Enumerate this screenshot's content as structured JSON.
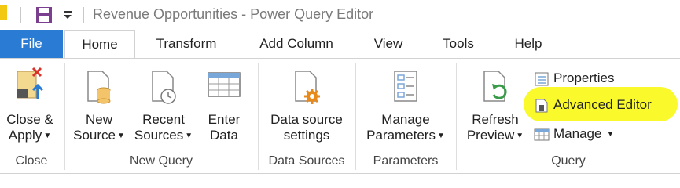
{
  "window": {
    "title": "Revenue Opportunities - Power Query Editor"
  },
  "tabs": [
    "File",
    "Home",
    "Transform",
    "Add Column",
    "View",
    "Tools",
    "Help"
  ],
  "groups": {
    "close": {
      "label": "Close",
      "close_apply": {
        "line1": "Close &",
        "line2": "Apply"
      }
    },
    "new_query": {
      "label": "New Query",
      "new_source": {
        "line1": "New",
        "line2": "Source"
      },
      "recent_sources": {
        "line1": "Recent",
        "line2": "Sources"
      },
      "enter_data": {
        "line1": "Enter",
        "line2": "Data"
      }
    },
    "data_sources": {
      "label": "Data Sources",
      "settings": {
        "line1": "Data source",
        "line2": "settings"
      }
    },
    "parameters": {
      "label": "Parameters",
      "manage": {
        "line1": "Manage",
        "line2": "Parameters"
      }
    },
    "query": {
      "label": "Query",
      "refresh": {
        "line1": "Refresh",
        "line2": "Preview"
      },
      "properties": "Properties",
      "advanced_editor": "Advanced Editor",
      "manage": "Manage"
    }
  },
  "colors": {
    "file_tab": "#2a7bd3",
    "highlight": "#f9f92c",
    "accent_orange": "#e8891c"
  }
}
